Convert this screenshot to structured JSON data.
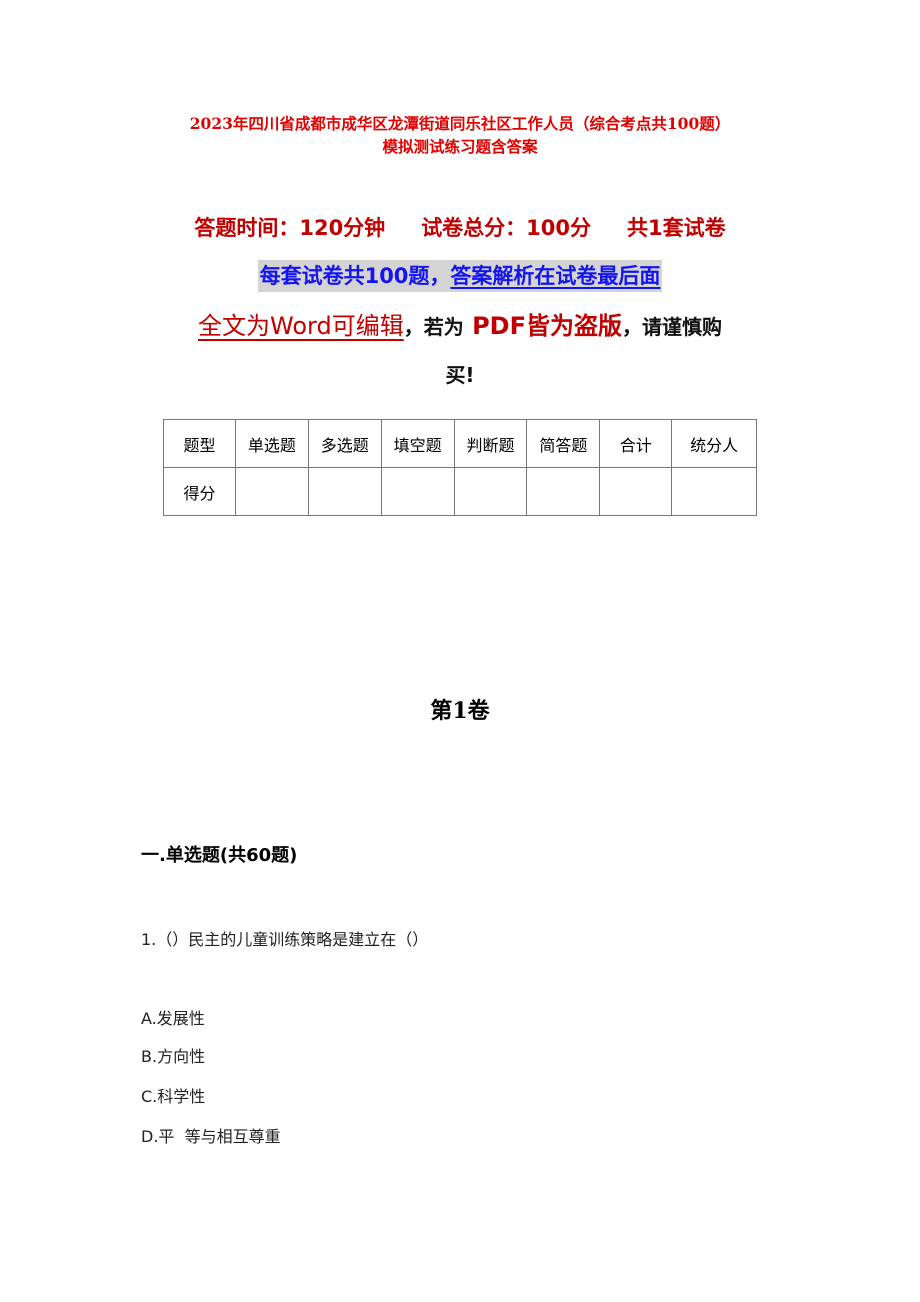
{
  "document": {
    "title_line1": "2023年四川省成都市成华区龙潭街道同乐社区工作人员（综合考点共100题）",
    "title_line2": "模拟测试练习题含答案",
    "meta": {
      "time": "答题时间：120分钟",
      "total_score": "试卷总分：100分",
      "sets": "共1套试卷"
    },
    "notice": {
      "part1": "每套试卷共100题，",
      "part2": "答案解析在试卷最后面"
    },
    "warning": {
      "editable": "全文为Word可编辑",
      "comma1": "，",
      "if_pdf": "若为",
      "pdf_pirated": "PDF皆为盗版",
      "comma2": "，",
      "caution": "请谨慎购",
      "caution_end": "买!"
    },
    "colors": {
      "title_red": "#e00000",
      "meta_red": "#c00000",
      "notice_blue": "#1414ee",
      "notice_bg": "#d4d4d4"
    }
  },
  "score_table": {
    "headers": [
      "题型",
      "单选题",
      "多选题",
      "填空题",
      "判断题",
      "简答题",
      "合计",
      "统分人"
    ],
    "row_label": "得分",
    "row_values": [
      "",
      "",
      "",
      "",
      "",
      "",
      ""
    ]
  },
  "volume": "第1卷",
  "section": {
    "title": "一.单选题(共60题)"
  },
  "questions": [
    {
      "number": "1.",
      "text": "（）民主的儿童训练策略是建立在（）",
      "options": [
        {
          "label": "A.",
          "text": "发展性"
        },
        {
          "label": "B.",
          "text": "方向性"
        },
        {
          "label": "C.",
          "text": "科学性"
        },
        {
          "label": "D.",
          "text": "平  等与相互尊重"
        }
      ]
    }
  ]
}
